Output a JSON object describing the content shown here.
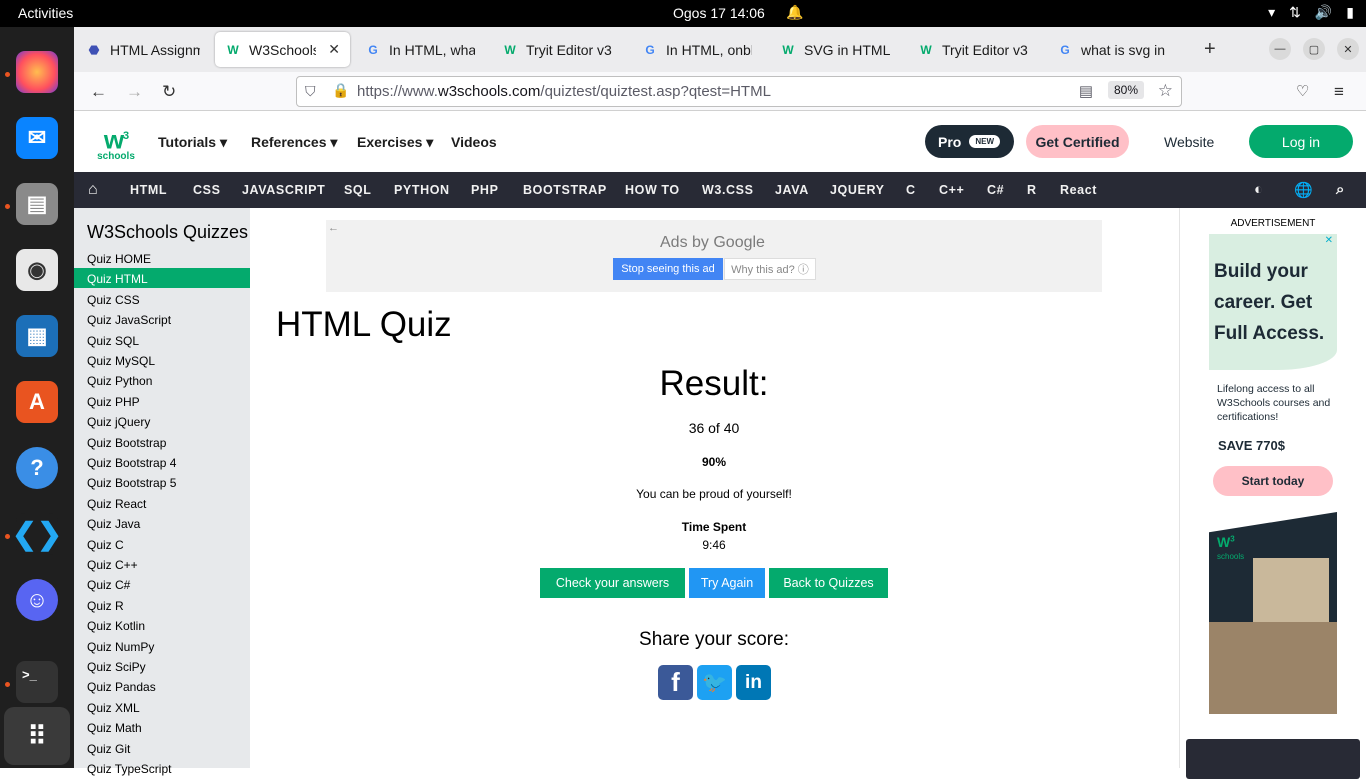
{
  "os": {
    "activities": "Activities",
    "clock": "Ogos 17  14:06"
  },
  "tabs": [
    {
      "label": "HTML Assignm",
      "icon": "google-classroom-icon"
    },
    {
      "label": "W3Schools",
      "icon": "w3schools-icon",
      "active": true
    },
    {
      "label": "In HTML, what",
      "icon": "google-icon"
    },
    {
      "label": "Tryit Editor v3",
      "icon": "w3schools-icon"
    },
    {
      "label": "In HTML, onbl",
      "icon": "google-icon"
    },
    {
      "label": "SVG in HTML",
      "icon": "w3schools-icon"
    },
    {
      "label": "Tryit Editor v3",
      "icon": "w3schools-icon"
    },
    {
      "label": "what is svg in",
      "icon": "google-icon"
    }
  ],
  "browser": {
    "url_prefix": "https://www.",
    "url_domain": "w3schools.com",
    "url_path": "/quiztest/quiztest.asp?qtest=HTML",
    "zoom": "80%"
  },
  "header": {
    "logo_text": "schools",
    "menus": [
      "Tutorials",
      "References",
      "Exercises",
      "Videos"
    ],
    "pro": "Pro",
    "pro_badge": "NEW",
    "cert": "Get Certified",
    "website": "Website",
    "login": "Log in"
  },
  "topnav": [
    "HTML",
    "CSS",
    "JAVASCRIPT",
    "SQL",
    "PYTHON",
    "PHP",
    "BOOTSTRAP",
    "HOW TO",
    "W3.CSS",
    "JAVA",
    "JQUERY",
    "C",
    "C++",
    "C#",
    "R",
    "React"
  ],
  "sidebar": {
    "title": "W3Schools Quizzes",
    "items": [
      "Quiz HOME",
      "Quiz HTML",
      "Quiz CSS",
      "Quiz JavaScript",
      "Quiz SQL",
      "Quiz MySQL",
      "Quiz Python",
      "Quiz PHP",
      "Quiz jQuery",
      "Quiz Bootstrap",
      "Quiz Bootstrap 4",
      "Quiz Bootstrap 5",
      "Quiz React",
      "Quiz Java",
      "Quiz C",
      "Quiz C++",
      "Quiz C#",
      "Quiz R",
      "Quiz Kotlin",
      "Quiz NumPy",
      "Quiz SciPy",
      "Quiz Pandas",
      "Quiz XML",
      "Quiz Math",
      "Quiz Git",
      "Quiz TypeScript"
    ],
    "active_index": 1
  },
  "ad_top": {
    "ads_by": "Ads by ",
    "google": "Google",
    "stop": "Stop seeing this ad",
    "why": "Why this ad? ⓘ"
  },
  "main": {
    "title": "HTML Quiz",
    "result_heading": "Result:",
    "score": "36 of 40",
    "percent": "90%",
    "message": "You can be proud of yourself!",
    "time_label": "Time Spent",
    "time_value": "9:46",
    "buttons": {
      "check": "Check your answers",
      "again": "Try Again",
      "back": "Back to Quizzes"
    },
    "share_heading": "Share your score:"
  },
  "right_ad": {
    "label": "ADVERTISEMENT",
    "headline": "Build your career. Get Full Access.",
    "sub": "Lifelong access to all W3Schools courses and certifications!",
    "save": "SAVE 770$",
    "cta": "Start today",
    "img_logo": "schools"
  },
  "colors": {
    "w3_green": "#04aa6d",
    "nav_dark": "#282a35",
    "tryagain_blue": "#2196f3"
  }
}
